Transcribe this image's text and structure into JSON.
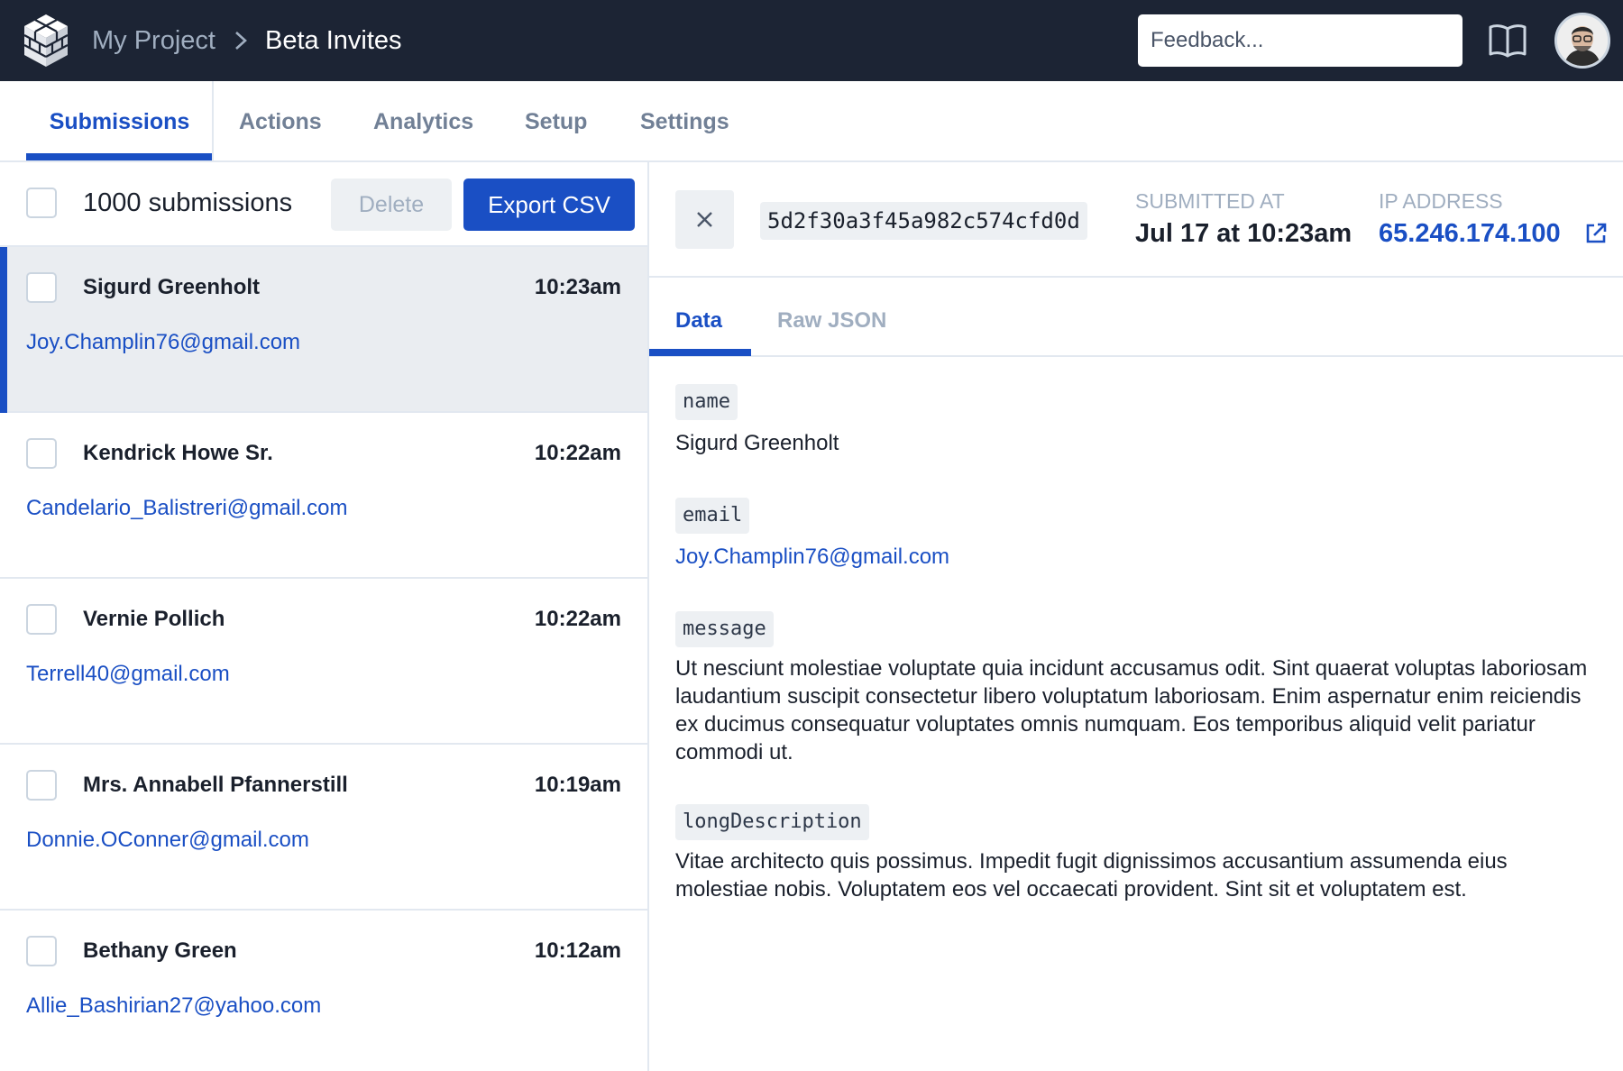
{
  "header": {
    "project": "My Project",
    "page": "Beta Invites",
    "feedback_placeholder": "Feedback..."
  },
  "tabs": [
    {
      "label": "Submissions",
      "active": true
    },
    {
      "label": "Actions"
    },
    {
      "label": "Analytics"
    },
    {
      "label": "Setup"
    },
    {
      "label": "Settings"
    }
  ],
  "list": {
    "count_label": "1000 submissions",
    "delete_label": "Delete",
    "export_label": "Export CSV",
    "items": [
      {
        "name": "Sigurd Greenholt",
        "time": "10:23am",
        "email": "Joy.Champlin76@gmail.com",
        "selected": true
      },
      {
        "name": "Kendrick Howe Sr.",
        "time": "10:22am",
        "email": "Candelario_Balistreri@gmail.com"
      },
      {
        "name": "Vernie Pollich",
        "time": "10:22am",
        "email": "Terrell40@gmail.com"
      },
      {
        "name": "Mrs. Annabell Pfannerstill",
        "time": "10:19am",
        "email": "Donnie.OConner@gmail.com"
      },
      {
        "name": "Bethany Green",
        "time": "10:12am",
        "email": "Allie_Bashirian27@yahoo.com"
      }
    ]
  },
  "detail": {
    "id": "5d2f30a3f45a982c574cfd0d",
    "submitted_label": "SUBMITTED AT",
    "submitted_value": "Jul 17 at 10:23am",
    "ip_label": "IP ADDRESS",
    "ip_value": "65.246.174.100",
    "subtabs": [
      {
        "label": "Data",
        "active": true
      },
      {
        "label": "Raw JSON"
      }
    ],
    "fields": [
      {
        "key": "name",
        "value": "Sigurd Greenholt"
      },
      {
        "key": "email",
        "value": "Joy.Champlin76@gmail.com"
      },
      {
        "key": "message",
        "value": "Ut nesciunt molestiae voluptate quia incidunt accusamus odit. Sint quaerat voluptas laboriosam laudantium suscipit consectetur libero voluptatum laboriosam. Enim aspernatur enim reiciendis ex ducimus consequatur voluptates omnis numquam. Eos temporibus aliquid velit pariatur commodi ut."
      },
      {
        "key": "longDescription",
        "value": "Vitae architecto quis possimus. Impedit fugit dignissimos accusantium assumenda eius molestiae nobis. Voluptatem eos vel occaecati provident. Sint sit et voluptatem est."
      }
    ]
  },
  "colors": {
    "topbar": "#1c2434",
    "accent": "#1a4fc4",
    "selected_row": "#eaedf1",
    "muted": "#a0aec0"
  },
  "icons": [
    "logo-icon",
    "chevron-right-icon",
    "book-icon",
    "avatar",
    "close-icon",
    "external-link-icon"
  ]
}
